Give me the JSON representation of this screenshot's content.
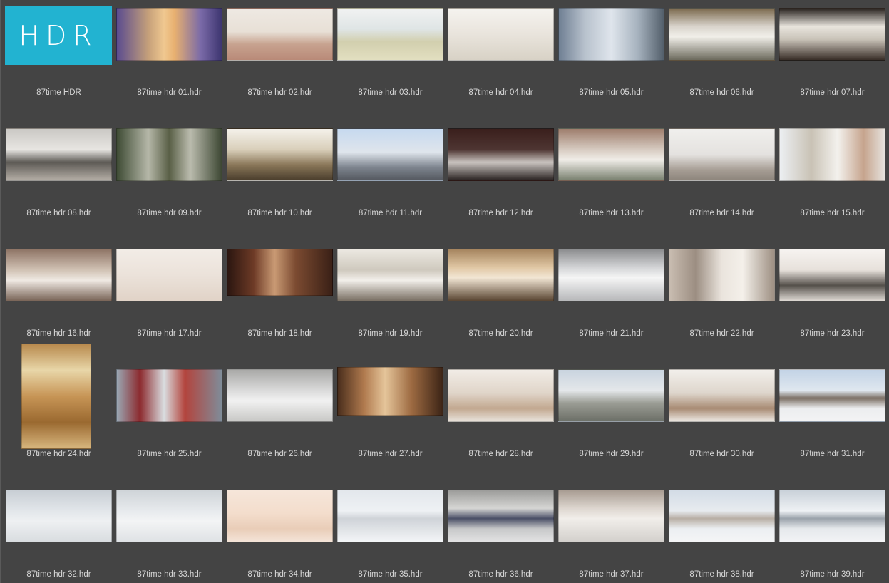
{
  "logo_text": "HDR",
  "items": [
    {
      "label": "87time HDR",
      "kind": "logo",
      "bg": "#22b3d1"
    },
    {
      "label": "87time hdr 01.hdr",
      "kind": "pano",
      "bg": "linear-gradient(90deg,#5a4b8f 0%,#c5a07a 30%,#f0c890 45%,#e8b070 55%,#7a6aa8 80%,#3d3570 100%)"
    },
    {
      "label": "87time hdr 02.hdr",
      "kind": "pano",
      "bg": "linear-gradient(180deg,#eee9e3 0%,#e8e0d6 45%,#c7a28f 70%,#b98a78 100%)"
    },
    {
      "label": "87time hdr 03.hdr",
      "kind": "pano",
      "bg": "linear-gradient(180deg,#f1f2f2 0%,#dfe5e5 40%,#d2cfae 65%,#e2dfc0 100%)"
    },
    {
      "label": "87time hdr 04.hdr",
      "kind": "pano",
      "bg": "linear-gradient(180deg,#f5f3ef 0%,#e9e4dc 50%,#d8d2c6 100%)"
    },
    {
      "label": "87time hdr 05.hdr",
      "kind": "pano",
      "bg": "linear-gradient(90deg,#6f7f93 0%,#b8c2cd 25%,#dfe5ec 50%,#a7b3bf 75%,#535f6b 100%)"
    },
    {
      "label": "87time hdr 06.hdr",
      "kind": "pano",
      "bg": "linear-gradient(180deg,#7c6a4e 0%,#d9d4cc 35%,#f1efe9 55%,#6d6b5e 100%)"
    },
    {
      "label": "87time hdr 07.hdr",
      "kind": "pano",
      "bg": "linear-gradient(180deg,#2a2420 0%,#e8e4dd 35%,#c9c3b8 60%,#3a2f29 100%)"
    },
    {
      "label": "87time hdr 08.hdr",
      "kind": "pano",
      "bg": "linear-gradient(180deg,#cac8c4 0%,#e7e5e1 40%,#5d5a55 65%,#b4ada5 100%)"
    },
    {
      "label": "87time hdr 09.hdr",
      "kind": "pano",
      "bg": "linear-gradient(90deg,#3e4b34 0%,#b5b7a8 30%,#595f46 50%,#bbbcae 70%,#3d4733 100%)"
    },
    {
      "label": "87time hdr 10.hdr",
      "kind": "pano",
      "bg": "linear-gradient(180deg,#f4f1ea 0%,#d9cfba 40%,#8a7759 70%,#4a3d2c 100%)"
    },
    {
      "label": "87time hdr 11.hdr",
      "kind": "pano",
      "bg": "linear-gradient(180deg,#c6d9ef 0%,#dfe5ec 45%,#7d848e 75%,#54585f 100%)"
    },
    {
      "label": "87time hdr 12.hdr",
      "kind": "pano",
      "bg": "linear-gradient(180deg,#3a1f1c 0%,#4e3532 40%,#c9c3bf 65%,#2a2322 100%)"
    },
    {
      "label": "87time hdr 13.hdr",
      "kind": "pano",
      "bg": "linear-gradient(180deg,#9e7e6d 0%,#d7cbc1 40%,#f0ede8 60%,#79806f 100%)"
    },
    {
      "label": "87time hdr 14.hdr",
      "kind": "pano",
      "bg": "linear-gradient(180deg,#f0efed 0%,#e4e2df 50%,#a69d94 80%,#8d857c 100%)"
    },
    {
      "label": "87time hdr 15.hdr",
      "kind": "pano",
      "bg": "linear-gradient(90deg,#eceff2 0%,#c9c2b5 30%,#f3f1ed 55%,#c6a48d 80%,#e6e3de 100%)"
    },
    {
      "label": "87time hdr 16.hdr",
      "kind": "pano",
      "bg": "linear-gradient(180deg,#8f7566 0%,#d1c2b4 40%,#efe9e3 60%,#7a6558 100%)"
    },
    {
      "label": "87time hdr 17.hdr",
      "kind": "pano",
      "bg": "linear-gradient(180deg,#f2ece6 0%,#ebe2da 50%,#e1d3c7 100%)"
    },
    {
      "label": "87time hdr 18.hdr",
      "kind": "pano-short",
      "bg": "linear-gradient(90deg,#2b1610 0%,#6d3a26 25%,#c99a74 45%,#7c4b31 65%,#3a2016 100%)"
    },
    {
      "label": "87time hdr 19.hdr",
      "kind": "pano",
      "bg": "linear-gradient(180deg,#ece8e1 0%,#cfc9be 40%,#f2efea 60%,#7a7064 100%)"
    },
    {
      "label": "87time hdr 20.hdr",
      "kind": "pano",
      "bg": "linear-gradient(180deg,#a6855f 0%,#e0c7a4 35%,#f2e6d4 55%,#5a4633 100%)"
    },
    {
      "label": "87time hdr 21.hdr",
      "kind": "pano",
      "bg": "linear-gradient(180deg,#8c8d8f 0%,#d3d4d6 35%,#f5f5f5 55%,#b7b8ba 100%)"
    },
    {
      "label": "87time hdr 22.hdr",
      "kind": "pano",
      "bg": "linear-gradient(90deg,#c9bdb1 0%,#9c8e82 25%,#eae4dd 50%,#f4f0ea 70%,#9d8f82 100%)"
    },
    {
      "label": "87time hdr 23.hdr",
      "kind": "pano",
      "bg": "linear-gradient(180deg,#f6f3f0 0%,#e7e1db 40%,#55504b 70%,#ddd8d2 100%)"
    },
    {
      "label": "87time hdr 24.hdr",
      "kind": "portrait",
      "bg": "linear-gradient(180deg,#b88a4e 0%,#e8d6a8 25%,#c79556 50%,#9a6930 75%,#d7b57d 100%)"
    },
    {
      "label": "87time hdr 25.hdr",
      "kind": "pano",
      "bg": "linear-gradient(90deg,#9aa7b3 0%,#8c2a2e 22%,#d9dde0 45%,#b3443d 65%,#7f8c99 100%)"
    },
    {
      "label": "87time hdr 26.hdr",
      "kind": "pano",
      "bg": "linear-gradient(180deg,#a9a9a7 0%,#dadada 40%,#f1f1f1 60%,#c8c8c6 100%)"
    },
    {
      "label": "87time hdr 27.hdr",
      "kind": "pano-shorter",
      "bg": "linear-gradient(90deg,#4a2e1c 0%,#b07a4e 25%,#e5c59a 45%,#9e6b42 70%,#3c2416 100%)"
    },
    {
      "label": "87time hdr 28.hdr",
      "kind": "pano",
      "bg": "linear-gradient(180deg,#f1ece6 0%,#e0d5c9 45%,#c2a890 75%,#e8e2da 100%)"
    },
    {
      "label": "87time hdr 29.hdr",
      "kind": "pano",
      "bg": "linear-gradient(180deg,#c9d4df 0%,#e4e7ea 40%,#9a9c94 65%,#6c6f67 100%)"
    },
    {
      "label": "87time hdr 30.hdr",
      "kind": "pano",
      "bg": "linear-gradient(180deg,#f2efeb 0%,#ded6cc 45%,#a88b74 75%,#ece7e1 100%)"
    },
    {
      "label": "87time hdr 31.hdr",
      "kind": "pano",
      "bg": "linear-gradient(180deg,#c3d3e6 0%,#dfe7ef 40%,#7b6f64 55%,#ecedef 75%,#f3f3f4 100%)"
    },
    {
      "label": "87time hdr 32.hdr",
      "kind": "pano",
      "bg": "linear-gradient(180deg,#c8ced4 0%,#e2e6ea 40%,#eef0f2 60%,#d9dde0 100%)"
    },
    {
      "label": "87time hdr 33.hdr",
      "kind": "pano",
      "bg": "linear-gradient(180deg,#cfd4d8 0%,#e7eaed 40%,#f3f4f5 60%,#dfe2e5 100%)"
    },
    {
      "label": "87time hdr 34.hdr",
      "kind": "pano",
      "bg": "linear-gradient(180deg,#f6e6da 0%,#f3ddcc 45%,#e9cdb8 75%,#f4e4d8 100%)"
    },
    {
      "label": "87time hdr 35.hdr",
      "kind": "pano",
      "bg": "linear-gradient(180deg,#e3e7ec 0%,#eef1f4 40%,#cfd3d8 55%,#f3f5f7 100%)"
    },
    {
      "label": "87time hdr 36.hdr",
      "kind": "pano",
      "bg": "linear-gradient(180deg,#9c9c9a 0%,#d6d6d4 35%,#4a4f66 55%,#c7c8c9 75%,#e2e2e3 100%)"
    },
    {
      "label": "87time hdr 37.hdr",
      "kind": "pano",
      "bg": "linear-gradient(180deg,#a89c92 0%,#ddd6cf 35%,#f1eeea 55%,#d3d0cc 100%)"
    },
    {
      "label": "87time hdr 38.hdr",
      "kind": "pano",
      "bg": "linear-gradient(180deg,#d3dce6 0%,#e7ebef 40%,#b8aea4 55%,#eceff2 75%,#f4f5f6 100%)"
    },
    {
      "label": "87time hdr 39.hdr",
      "kind": "pano",
      "bg": "linear-gradient(180deg,#c9d1d9 0%,#eef1f4 40%,#9aa2aa 55%,#e6e9ec 75%,#f2f3f5 100%)"
    }
  ]
}
